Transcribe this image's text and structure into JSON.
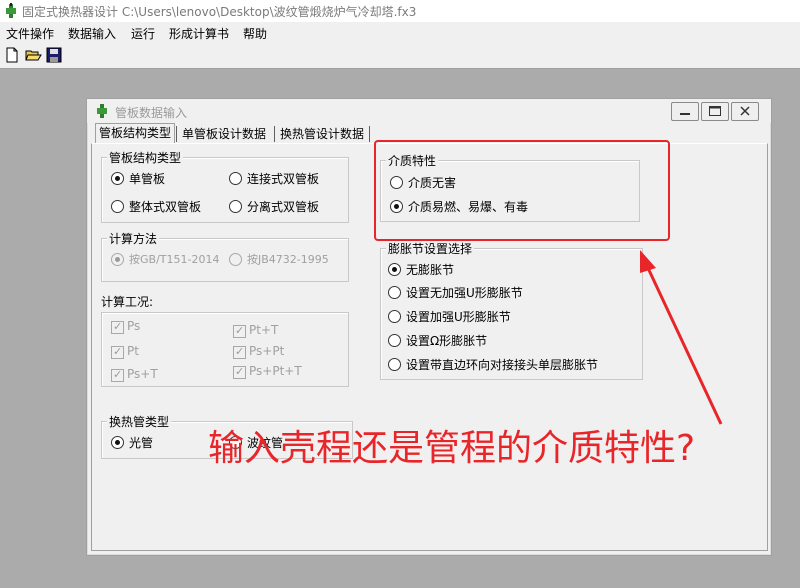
{
  "window": {
    "title": "固定式换热器设计 C:\\Users\\lenovo\\Desktop\\波纹管煅烧炉气冷却塔.fx3"
  },
  "menu": {
    "items": [
      "文件操作",
      "数据输入",
      "运行",
      "形成计算书",
      "帮助"
    ]
  },
  "toolbar": {
    "icons": [
      "new-file-icon",
      "open-folder-icon",
      "save-icon"
    ]
  },
  "dialog": {
    "title": "管板数据输入",
    "tabs": [
      "管板结构类型",
      "单管板设计数据",
      "换热管设计数据"
    ],
    "tube_plate_structure": {
      "title": "管板结构类型",
      "options": [
        "单管板",
        "连接式双管板",
        "整体式双管板",
        "分离式双管板"
      ],
      "selected": "单管板"
    },
    "calc_method": {
      "title": "计算方法",
      "options": [
        "按GB/T151-2014",
        "按JB4732-1995"
      ],
      "selected": "按GB/T151-2014"
    },
    "calc_conditions": {
      "title": "计算工况:",
      "items": [
        "Ps",
        "Pt+T",
        "Pt",
        "Ps+Pt",
        "Ps+T",
        "Ps+Pt+T"
      ]
    },
    "tube_type": {
      "title": "换热管类型",
      "options": [
        "光管",
        "波纹管"
      ],
      "selected": "光管"
    },
    "medium": {
      "title": "介质特性",
      "options": [
        "介质无害",
        "介质易燃、易爆、有毒"
      ],
      "selected": "介质易燃、易爆、有毒"
    },
    "expansion_joint": {
      "title": "膨胀节设置选择",
      "options": [
        "无膨胀节",
        "设置无加强U形膨胀节",
        "设置加强U形膨胀节",
        "设置Ω形膨胀节",
        "设置带直边环向对接接头单层膨胀节"
      ],
      "selected": "无膨胀节"
    }
  },
  "annotation": {
    "text": "输入壳程还是管程的介质特性?"
  },
  "colors": {
    "annotation": "#e8262a",
    "mdi_background": "#ababab",
    "dialog": "#f0f0f0"
  }
}
